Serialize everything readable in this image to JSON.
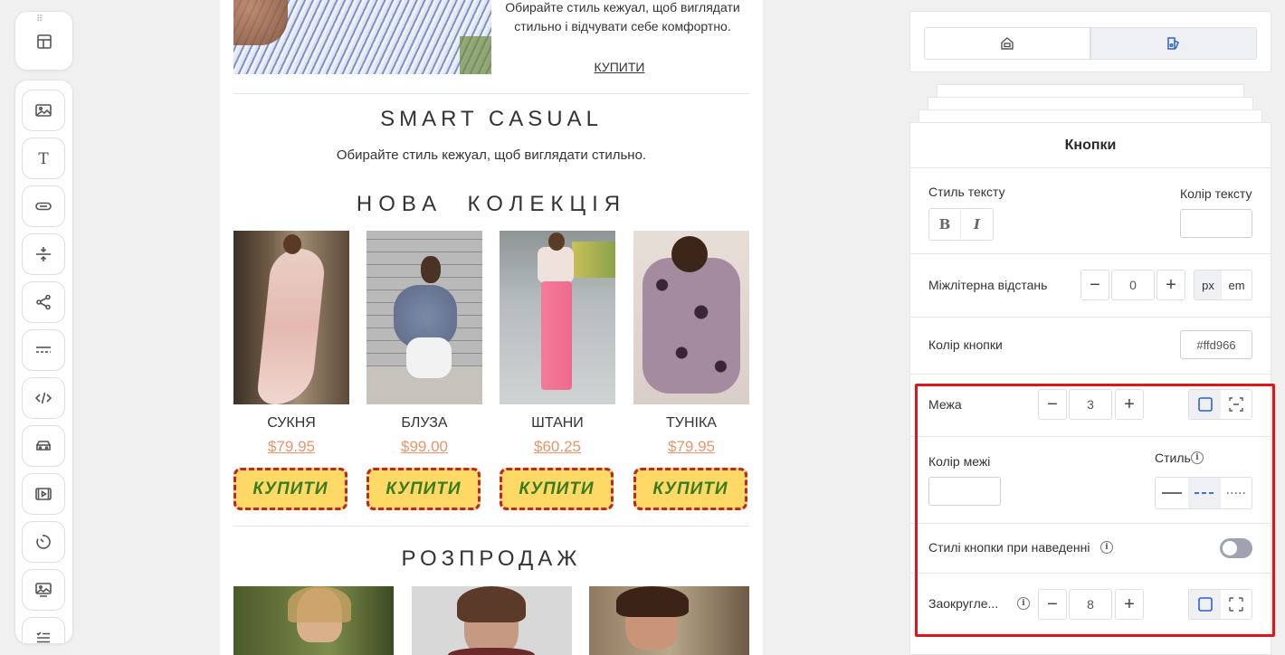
{
  "colors": {
    "button_bg": "#ffd966",
    "button_text": "#3b7a1f",
    "price": "#e8956d",
    "accent_blue": "#2e5fd0",
    "highlight": "#e0141b"
  },
  "toolbar": {
    "top_icon": "layout-icon",
    "items": [
      {
        "name": "image-block-icon"
      },
      {
        "name": "text-block-icon"
      },
      {
        "name": "button-block-icon"
      },
      {
        "name": "spacer-block-icon"
      },
      {
        "name": "social-block-icon"
      },
      {
        "name": "divider-block-icon"
      },
      {
        "name": "html-block-icon"
      },
      {
        "name": "menu-block-icon"
      },
      {
        "name": "video-block-icon"
      },
      {
        "name": "timer-block-icon"
      },
      {
        "name": "banner-block-icon"
      },
      {
        "name": "list-block-icon"
      }
    ]
  },
  "email": {
    "hero": {
      "text": "Обирайте стиль кежуал, щоб виглядати стильно і відчувати себе комфортно.",
      "buy_link": "КУПИТИ"
    },
    "smart_casual": {
      "heading": "SMART CASUAL",
      "text": "Обирайте стиль кежуал, щоб виглядати стильно."
    },
    "new_collection": {
      "heading": "НОВА  КОЛЕКЦІЯ",
      "products": [
        {
          "name": "СУКНЯ",
          "price": "$79.95",
          "button": "КУПИТИ"
        },
        {
          "name": "БЛУЗА",
          "price": "$99.00",
          "button": "КУПИТИ"
        },
        {
          "name": "ШТАНИ",
          "price": "$60.25",
          "button": "КУПИТИ"
        },
        {
          "name": "ТУНІКА",
          "price": "$79.95",
          "button": "КУПИТИ"
        }
      ]
    },
    "sale": {
      "heading": "РОЗПРОДАЖ"
    }
  },
  "panel": {
    "tabs": [
      {
        "icon": "content-tab-icon",
        "active": false
      },
      {
        "icon": "styles-tab-icon",
        "active": true
      }
    ],
    "title": "Кнопки",
    "text_style": {
      "label": "Стиль тексту",
      "bold": "B",
      "italic": "I"
    },
    "text_color": {
      "label": "Колір тексту",
      "value": ""
    },
    "letter_spacing": {
      "label": "Міжлітерна відстань",
      "value": "0",
      "minus": "−",
      "plus": "+",
      "units": [
        "px",
        "em"
      ],
      "selected_unit": "px"
    },
    "button_color": {
      "label": "Колір кнопки",
      "value": "#ffd966"
    },
    "border": {
      "label": "Межа",
      "value": "3",
      "minus": "−",
      "plus": "+",
      "mode": "all-sides"
    },
    "border_color": {
      "label": "Колір межі",
      "value": ""
    },
    "border_style": {
      "label": "Стиль",
      "options": [
        "solid",
        "dashed",
        "dotted"
      ],
      "selected": "dashed"
    },
    "hover_styles": {
      "label": "Стилі кнопки при наведенні",
      "enabled": false
    },
    "rounding": {
      "label": "Заокругле...",
      "value": "8",
      "minus": "−",
      "plus": "+",
      "mode": "all-corners"
    }
  }
}
